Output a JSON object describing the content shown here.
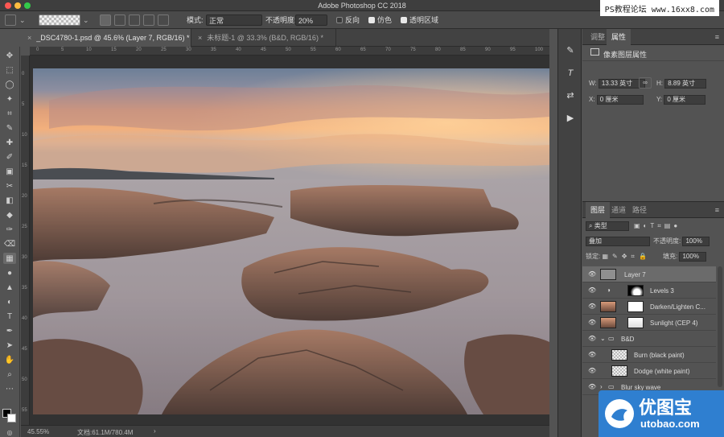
{
  "app": {
    "title": "Adobe Photoshop CC 2018",
    "watermark_top": "PS教程论坛 www.16xx8.com"
  },
  "options": {
    "mode_label": "模式:",
    "mode_value": "正常",
    "opacity_label": "不透明度:",
    "opacity_value": "20%",
    "reverse_label": "反向",
    "dither_label": "仿色",
    "transparency_label": "透明区域"
  },
  "tabs": [
    {
      "label": "_DSC4780-1.psd @ 45.6% (Layer 7, RGB/16) *",
      "active": true
    },
    {
      "label": "未标题-1 @ 33.3% (B&D, RGB/16) *",
      "active": false
    }
  ],
  "ruler_ticks_top": [
    "0",
    "5",
    "10",
    "15",
    "20",
    "25",
    "30",
    "35",
    "40",
    "45",
    "50",
    "55",
    "60",
    "65",
    "70",
    "75",
    "80",
    "85",
    "90",
    "95",
    "100"
  ],
  "ruler_ticks_left": [
    "0",
    "5",
    "10",
    "15",
    "20",
    "25",
    "30",
    "35",
    "40",
    "45",
    "50",
    "55"
  ],
  "status": {
    "zoom": "45.55%",
    "doc": "文档:61.1M/780.4M"
  },
  "properties": {
    "tab_adjust": "调整",
    "tab_props": "属性",
    "section": "像素图层属性",
    "w_label": "W:",
    "w_value": "13.33 英寸",
    "h_label": "H:",
    "h_value": "8.89 英寸",
    "x_label": "X:",
    "x_value": "0 厘米",
    "y_label": "Y:",
    "y_value": "0 厘米"
  },
  "layers_panel": {
    "tab_layers": "图层",
    "tab_channels": "通道",
    "tab_paths": "路径",
    "filter_label": "类型",
    "blend_mode": "叠加",
    "opacity_label": "不透明度:",
    "opacity_value": "100%",
    "lock_label": "锁定:",
    "fill_label": "填充:",
    "fill_value": "100%",
    "layers": [
      {
        "name": "Layer 7",
        "type": "pixel",
        "selected": true
      },
      {
        "name": "Levels 3",
        "type": "adjust-mask"
      },
      {
        "name": "Darken/Lighten C...",
        "type": "photo-mask"
      },
      {
        "name": "Sunlight (CEP 4)",
        "type": "photo-mask"
      },
      {
        "name": "B&D",
        "type": "group"
      },
      {
        "name": "Burn (black paint)",
        "type": "sub"
      },
      {
        "name": "Dodge (white paint)",
        "type": "sub"
      },
      {
        "name": "Blur sky wave",
        "type": "group"
      }
    ]
  },
  "watermark_bottom": {
    "text_cn": "优图宝",
    "text_en": "utobao.com"
  },
  "colors": {
    "accent": "#2f7fd0",
    "panel": "#535353",
    "dark": "#3e3e3e"
  }
}
